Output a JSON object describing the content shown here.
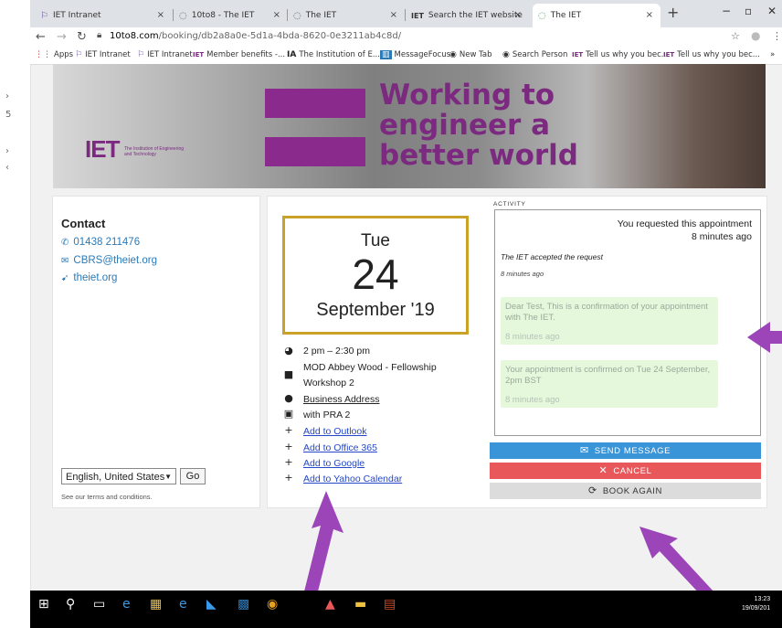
{
  "browser": {
    "tabs": [
      {
        "title": "IET Intranet",
        "icon": "intranet-icon"
      },
      {
        "title": "10to8 - The IET",
        "icon": "loading-icon"
      },
      {
        "title": "The IET",
        "icon": "loading-icon"
      },
      {
        "title": "Search the IET website",
        "icon": "iet-icon"
      },
      {
        "title": "The IET",
        "icon": "loading-icon"
      }
    ],
    "url_host": "10to8.com",
    "url_path": "/booking/db2a8a0e-5d1a-4bda-8620-0e3211ab4c8d/",
    "bookmarks": [
      "Apps",
      "IET Intranet",
      "IET Intranet",
      "Member benefits -...",
      "The Institution of E...",
      "MessageFocus",
      "New Tab",
      "Search Person",
      "Tell us why you bec...",
      "Tell us why you bec..."
    ],
    "bookmark_badges": {
      "iet": "IET",
      "ia": "IA"
    }
  },
  "banner": {
    "headline": [
      "Working to",
      "engineer a",
      "better world"
    ],
    "logo_text": "IET",
    "logo_sub": "The Institution of Engineering and Technology"
  },
  "contact": {
    "heading": "Contact",
    "phone": "01438 211476",
    "email": "CBRS@theiet.org",
    "website": "theiet.org",
    "language": "English, United States",
    "go_label": "Go",
    "terms": "See our terms and conditions."
  },
  "appointment": {
    "weekday": "Tue",
    "day": "24",
    "month_year": "September '19",
    "time": "2 pm – 2:30 pm",
    "location_line1": "MOD Abbey Wood - Fellowship",
    "location_line2": "Workshop 2",
    "address_link": "Business Address",
    "staff": "with PRA 2",
    "calendar_links": [
      "Add to Outlook",
      "Add to Office 365",
      "Add to Google",
      "Add to Yahoo Calendar"
    ]
  },
  "activity": {
    "label": "ACTIVITY",
    "requested": "You requested this appointment",
    "requested_time": "8 minutes ago",
    "accepted": "The IET accepted the request",
    "accepted_time": "8 minutes ago",
    "messages": [
      {
        "text": "Dear Test, This is a confirmation of your appointment with The IET.",
        "time": "8 minutes ago"
      },
      {
        "text": "Your appointment is confirmed on Tue 24 September, 2pm BST",
        "time": "8 minutes ago"
      }
    ]
  },
  "actions": {
    "send": "SEND MESSAGE",
    "cancel": "CANCEL",
    "book_again": "BOOK AGAIN"
  },
  "taskbar": {
    "time": "13:23",
    "date": "19/09/201"
  },
  "colors": {
    "brand_purple": "#7b2a80",
    "date_border": "#c9a227",
    "link_blue": "#2448c8",
    "send_blue": "#3a95d8",
    "cancel_red": "#e8585b",
    "annotation_arrow": "#9b45b8"
  }
}
